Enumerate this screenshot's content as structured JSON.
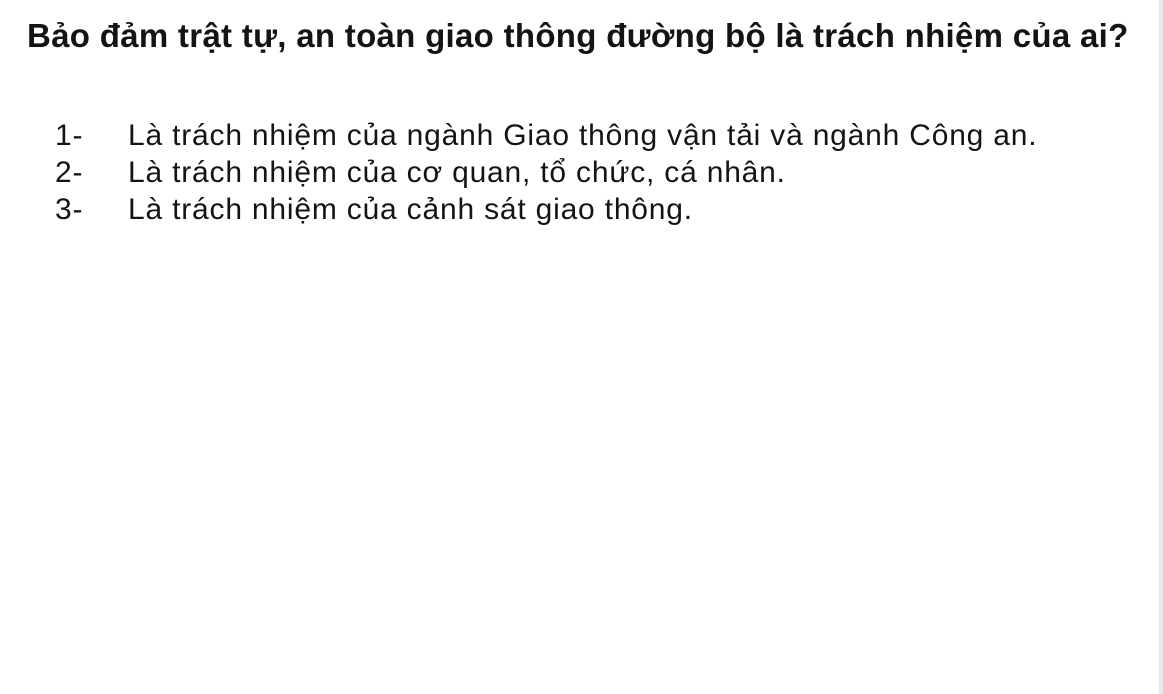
{
  "question": {
    "text": "Bảo đảm trật tự, an toàn giao thông đường bộ là trách nhiệm của ai?"
  },
  "answers": [
    {
      "number": "1-",
      "text": "Là trách nhiệm của ngành Giao thông vận tải và ngành Công an."
    },
    {
      "number": "2-",
      "text": "Là trách nhiệm của cơ quan, tổ chức, cá nhân."
    },
    {
      "number": "3-",
      "text": "Là trách nhiệm của cảnh sát giao thông."
    }
  ]
}
